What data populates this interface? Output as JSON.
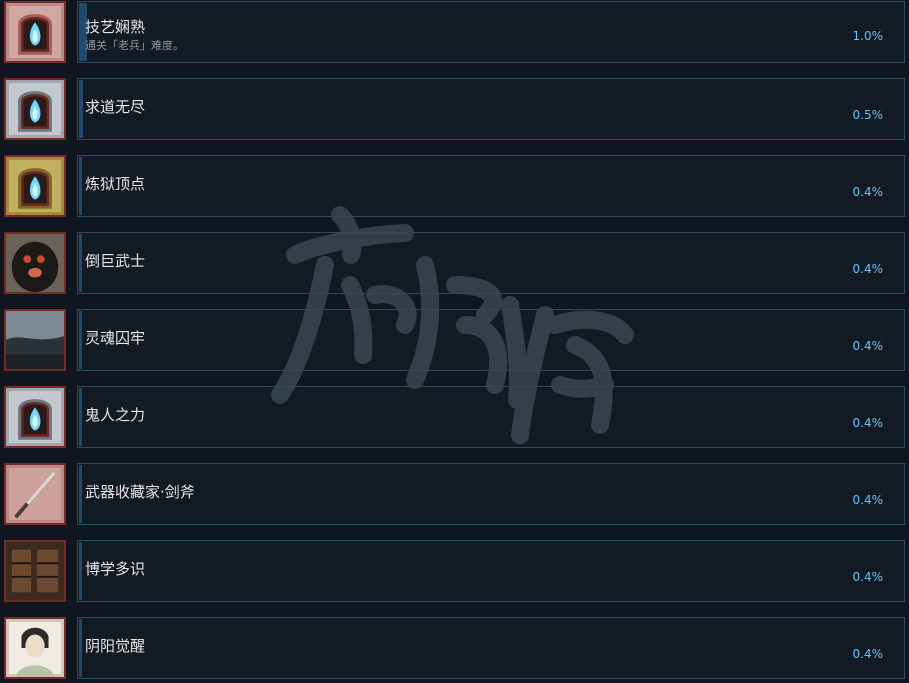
{
  "achievements": [
    {
      "name": "技艺娴熟",
      "description": "通关「老兵」难度。",
      "percent": "1.0%",
      "percent_value": 1.0,
      "icon": "blue-flame-frame-icon",
      "icon_tone": "rose"
    },
    {
      "name": "求道无尽",
      "description": "",
      "percent": "0.5%",
      "percent_value": 0.5,
      "icon": "blue-flame-frame-icon",
      "icon_tone": "silver"
    },
    {
      "name": "炼狱顶点",
      "description": "",
      "percent": "0.4%",
      "percent_value": 0.4,
      "icon": "blue-flame-frame-icon",
      "icon_tone": "gold"
    },
    {
      "name": "倒巨武士",
      "description": "",
      "percent": "0.4%",
      "percent_value": 0.4,
      "icon": "giant-monster-icon",
      "icon_tone": "dark"
    },
    {
      "name": "灵魂囚牢",
      "description": "",
      "percent": "0.4%",
      "percent_value": 0.4,
      "icon": "stormy-landscape-icon",
      "icon_tone": "gray"
    },
    {
      "name": "鬼人之力",
      "description": "",
      "percent": "0.4%",
      "percent_value": 0.4,
      "icon": "blue-flame-frame-icon",
      "icon_tone": "silver"
    },
    {
      "name": "武器收藏家·剑斧",
      "description": "",
      "percent": "0.4%",
      "percent_value": 0.4,
      "icon": "sword-axe-icon",
      "icon_tone": "rose"
    },
    {
      "name": "博学多识",
      "description": "",
      "percent": "0.4%",
      "percent_value": 0.4,
      "icon": "library-shelves-icon",
      "icon_tone": "brown"
    },
    {
      "name": "阴阳觉醒",
      "description": "",
      "percent": "0.4%",
      "percent_value": 0.4,
      "icon": "onmyoji-portrait-icon",
      "icon_tone": "light"
    }
  ],
  "colors": {
    "background": "#10161f",
    "card": "#121a24",
    "card_border": "#2a4a5e",
    "progress_fill": "#1e4b6f",
    "percent_text": "#67c1f5",
    "name_text": "#e6e6e6",
    "desc_text": "#8f98a0",
    "icon_border": "#7a2a24",
    "watermark": "#3a4651"
  }
}
